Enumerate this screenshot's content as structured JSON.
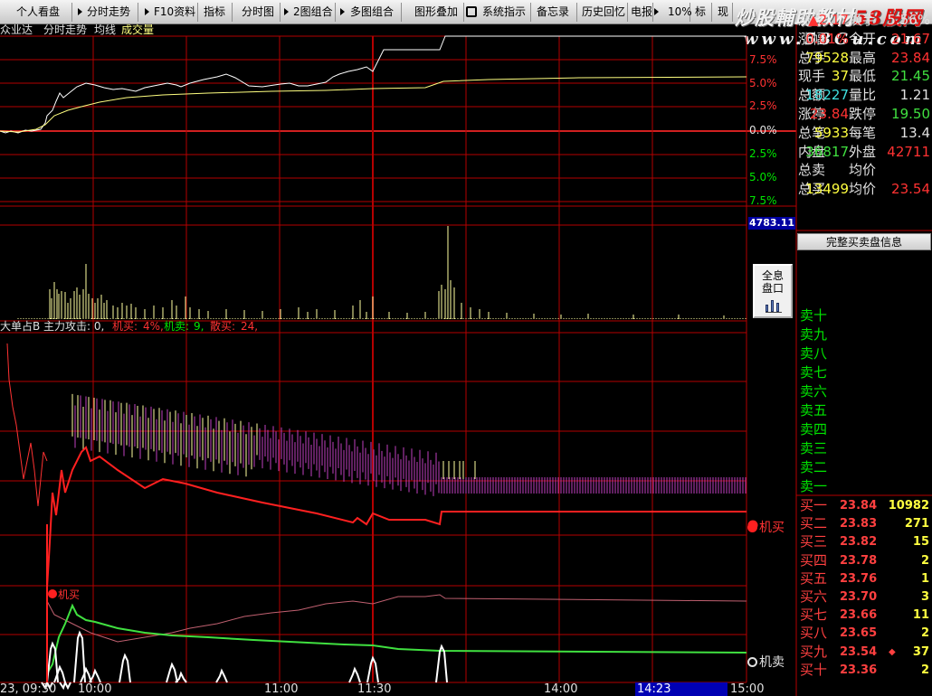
{
  "toolbar": {
    "items": [
      "个人看盘",
      "分时走势",
      "F10资料",
      "指标",
      "分时图",
      "2图组合",
      "多图组合",
      "图形叠加",
      "系统指示",
      "备忘录",
      "历史回忆",
      "电报",
      "10%",
      "标",
      "现"
    ]
  },
  "watermark": {
    "logo_a": "炒股輔助教材",
    "logo_b": "58股网",
    "url": "www.58Gu.com"
  },
  "chart_header": {
    "stock": "众业达",
    "title": "分时走势",
    "avg": "均线",
    "vol": "成交量"
  },
  "indicator_header": {
    "name": "大单占B",
    "attack": "主力攻击: 0,",
    "jm_label": "机买:",
    "jm_val": "4%,",
    "jmai_label": "机卖:",
    "jmai_val": "9,",
    "sm_label": "散买:",
    "sm_val": "24,"
  },
  "pct_labels": {
    "up3": "7.5%",
    "up2": "5.0%",
    "up1": "2.5%",
    "zero": "0.0%",
    "dn1": "2.5%",
    "dn2": "5.0%",
    "dn3": "7.5%"
  },
  "index_value": "4783.11",
  "full_button": {
    "line1": "全息",
    "line2": "盘口"
  },
  "info_button": "完整买卖盘信息",
  "info": {
    "r1": {
      "l1": "涨跌",
      "v1": "▲2.17",
      "l2": "换手",
      "v2": "5.56%"
    },
    "r2": {
      "l1": "涨幅",
      "v1": "0.01%",
      "l2": "今开",
      "v2": "21.67"
    },
    "r3": {
      "l1": "总手",
      "v1": "79528",
      "l2": "最高",
      "v2": "23.84"
    },
    "r4": {
      "l1": "现手",
      "v1": "37",
      "l2": "最低",
      "v2": "21.45"
    },
    "r5": {
      "l1": "总额",
      "v1": "18227",
      "l2": "量比",
      "v2": "1.21"
    },
    "r6": {
      "l1": "涨停",
      "v1": "23.84",
      "l2": "跌停",
      "v2": "19.50"
    },
    "r7": {
      "l1": "总笔",
      "v1": "5933",
      "l2": "每笔",
      "v2": "13.4"
    },
    "r8": {
      "l1": "内盘",
      "v1": "36817",
      "l2": "外盘",
      "v2": "42711"
    },
    "r9": {
      "l1": "总卖",
      "v1": "",
      "l2": "均价",
      "v2": ""
    },
    "r10": {
      "l1": "总买",
      "v1": "13499",
      "l2": "均价",
      "v2": "23.54"
    }
  },
  "sell_book": [
    "卖十",
    "卖九",
    "卖八",
    "卖七",
    "卖六",
    "卖五",
    "卖四",
    "卖三",
    "卖二",
    "卖一"
  ],
  "buy_book": [
    {
      "label": "买一",
      "price": "23.84",
      "vol": "10982"
    },
    {
      "label": "买二",
      "price": "23.83",
      "vol": "271"
    },
    {
      "label": "买三",
      "price": "23.82",
      "vol": "15"
    },
    {
      "label": "买四",
      "price": "23.78",
      "vol": "2"
    },
    {
      "label": "买五",
      "price": "23.76",
      "vol": "1"
    },
    {
      "label": "买六",
      "price": "23.70",
      "vol": "3"
    },
    {
      "label": "买七",
      "price": "23.66",
      "vol": "11"
    },
    {
      "label": "买八",
      "price": "23.65",
      "vol": "2"
    },
    {
      "label": "买九",
      "price": "23.54",
      "vol": "37"
    },
    {
      "label": "买十",
      "price": "23.36",
      "vol": "2"
    }
  ],
  "legend": {
    "jm": "机买",
    "jmai": "机卖",
    "marker": "机买"
  },
  "time_axis": {
    "t0": "23, 09:30",
    "t1": "10:00",
    "t2": "11:00",
    "t3": "11:30",
    "t4": "14:00",
    "t5": "14:23",
    "t6": "15:00"
  },
  "colors": {
    "grid": "#b40000",
    "up": "#ff3232",
    "down": "#00e600",
    "price": "#ffffff",
    "avg": "#ffff80",
    "purple": "#c040c0",
    "yellow": "#ffffa0",
    "green_line": "#40e040"
  }
}
